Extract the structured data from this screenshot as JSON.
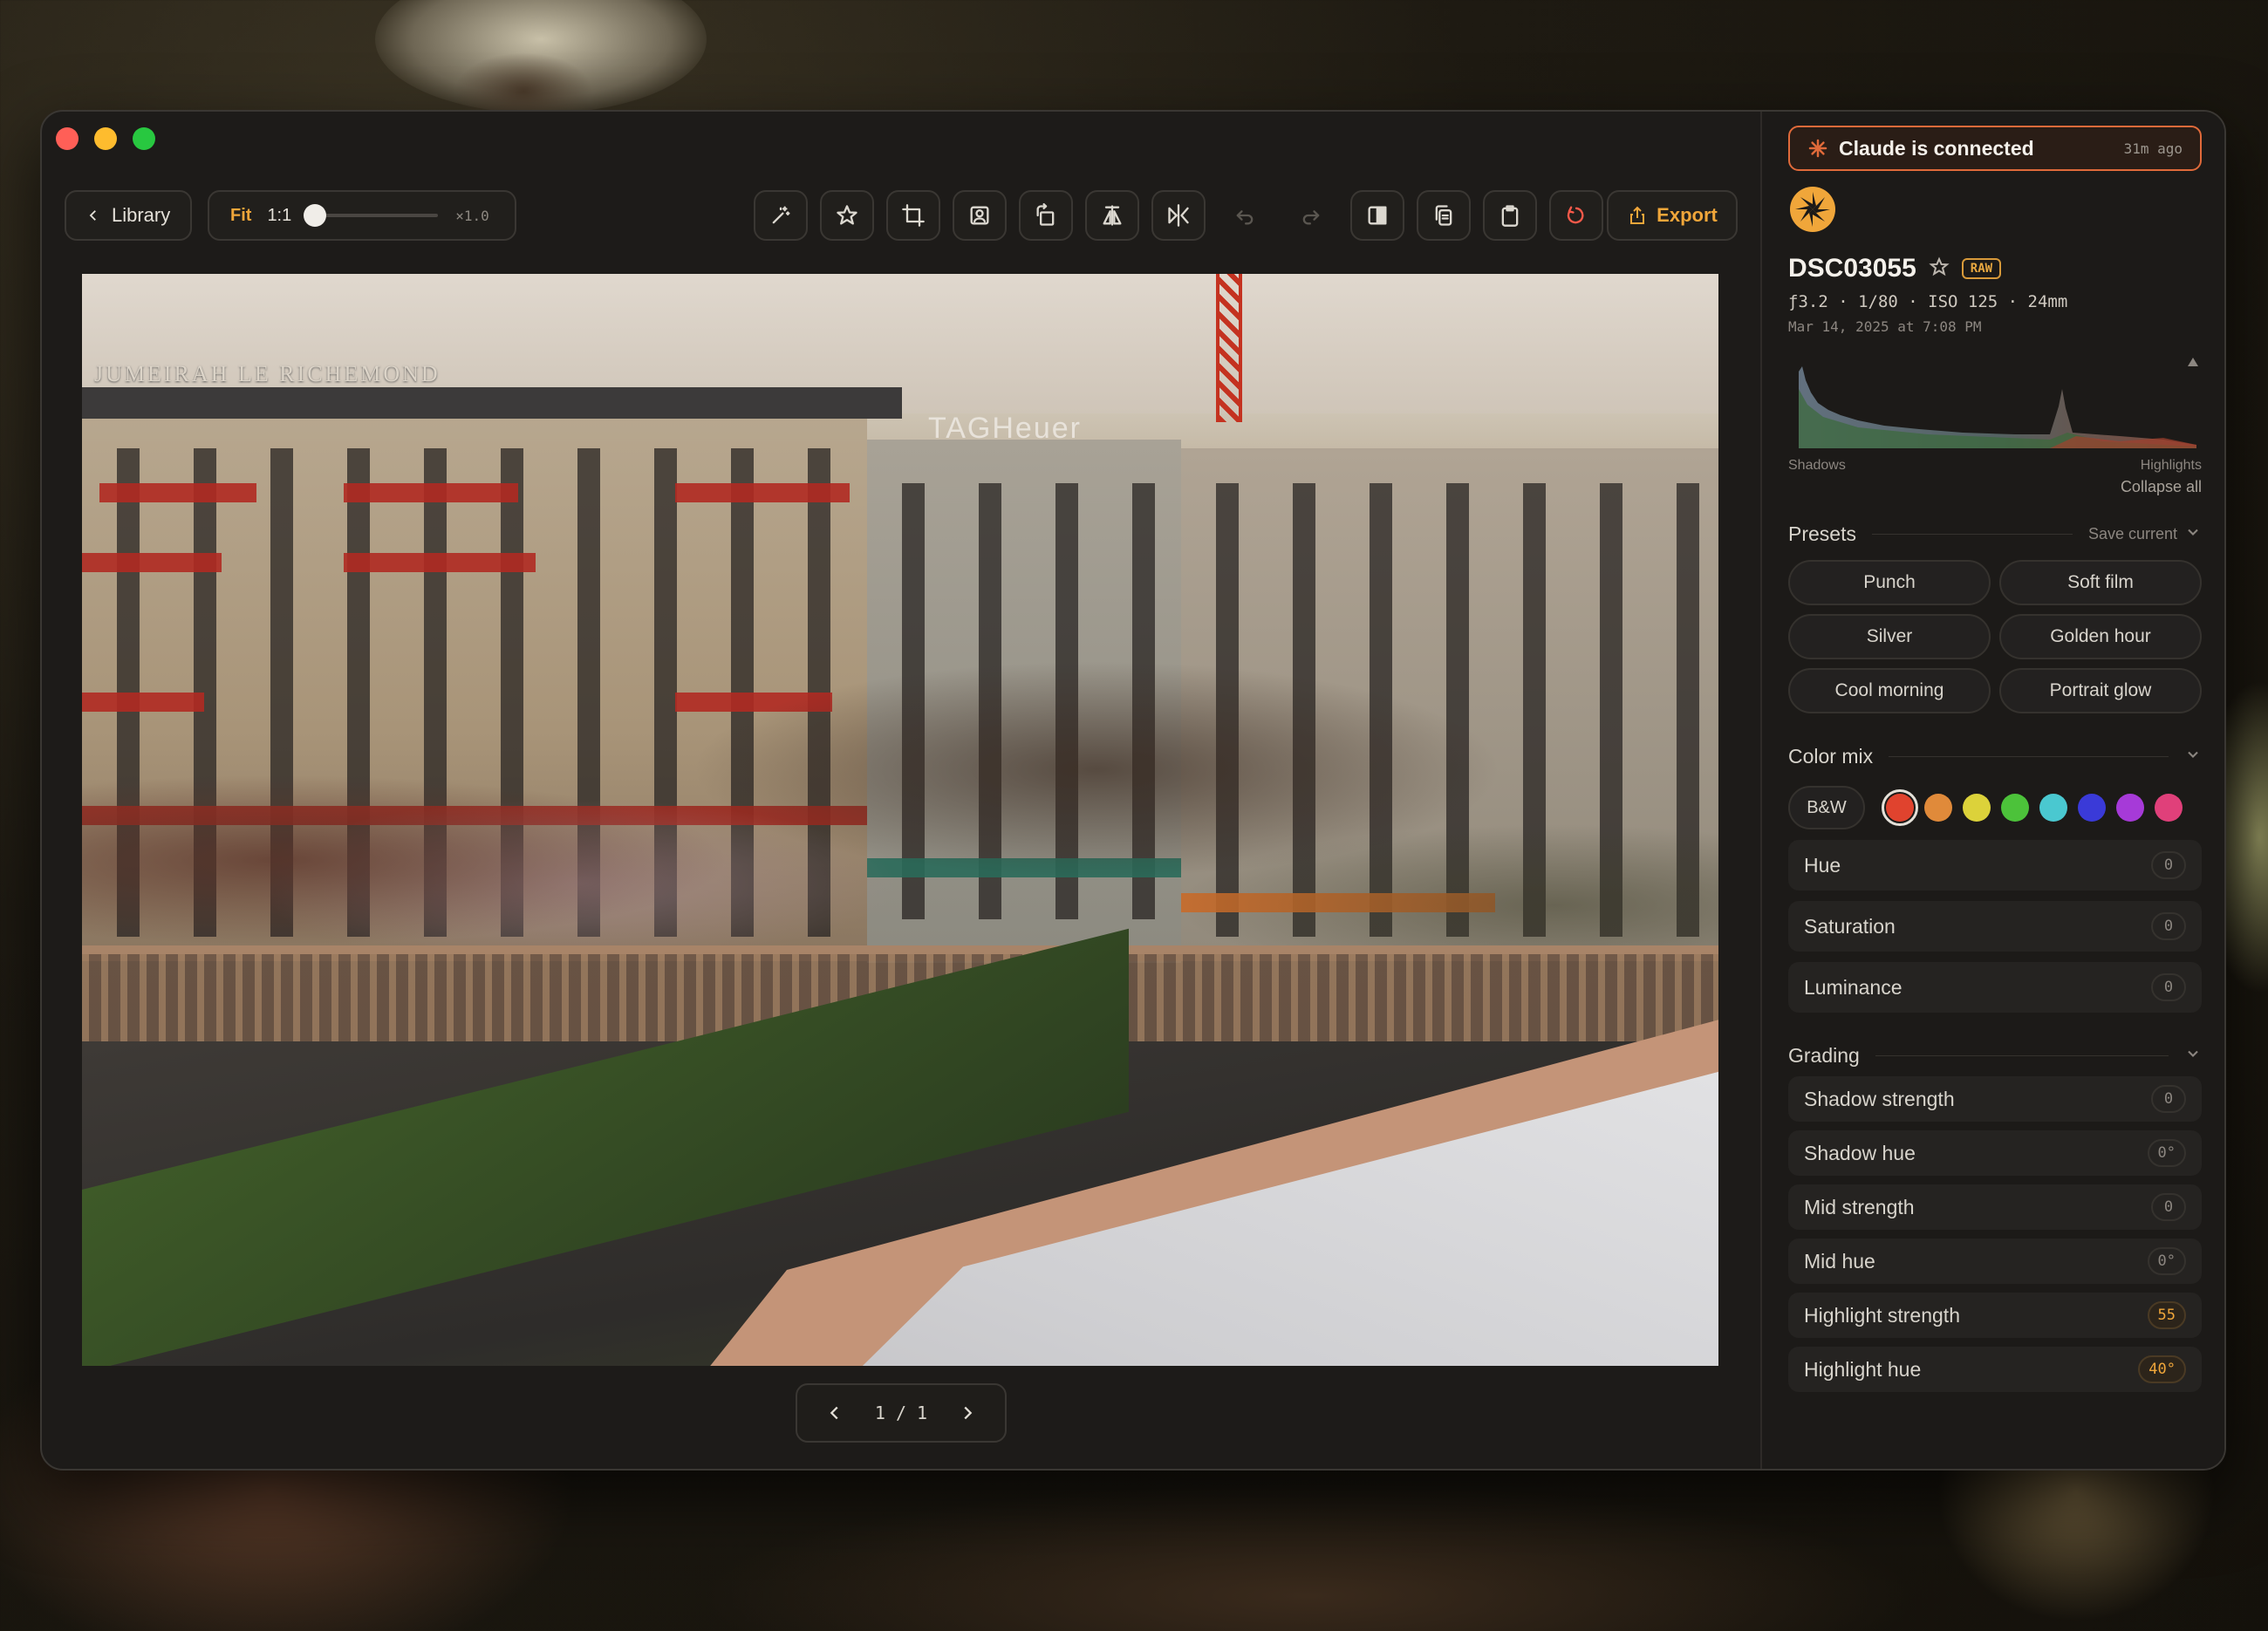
{
  "toolbar": {
    "library_label": "Library",
    "fit_label": "Fit",
    "one_to_one_label": "1:1",
    "zoom_multiplier": "×1.0",
    "zoom_value": 0.0,
    "export_label": "Export"
  },
  "photo": {
    "sign_left": "JUMEIRAH LE RICHEMOND",
    "sign_center": "TAGHeuer"
  },
  "pager": {
    "text": "1 / 1"
  },
  "sidebar": {
    "claude_status": "Claude is connected",
    "claude_ago": "31m ago",
    "file_name": "DSC03055",
    "raw_badge": "RAW",
    "exif": "ƒ3.2 · 1/80 · ISO 125 · 24mm",
    "date": "Mar 14, 2025 at 7:08 PM",
    "hist_shadows": "Shadows",
    "hist_highlights": "Highlights",
    "collapse_all": "Collapse all",
    "presets": {
      "title": "Presets",
      "save_current": "Save current",
      "items": [
        "Punch",
        "Soft film",
        "Silver",
        "Golden hour",
        "Cool morning",
        "Portrait glow"
      ]
    },
    "color_mix": {
      "title": "Color mix",
      "bw_label": "B&W",
      "swatches": [
        "#e0432e",
        "#e08a3a",
        "#dcd23a",
        "#4cc23a",
        "#4ac8d0",
        "#3a3ad8",
        "#a63ad8",
        "#e0407a"
      ],
      "rows": [
        {
          "label": "Hue",
          "value": "0"
        },
        {
          "label": "Saturation",
          "value": "0"
        },
        {
          "label": "Luminance",
          "value": "0"
        }
      ]
    },
    "grading": {
      "title": "Grading",
      "rows": [
        {
          "label": "Shadow strength",
          "value": "0",
          "active": false
        },
        {
          "label": "Shadow hue",
          "value": "0°",
          "active": false
        },
        {
          "label": "Mid strength",
          "value": "0",
          "active": false
        },
        {
          "label": "Mid hue",
          "value": "0°",
          "active": false
        },
        {
          "label": "Highlight strength",
          "value": "55",
          "active": true
        },
        {
          "label": "Highlight hue",
          "value": "40°",
          "active": true
        }
      ]
    }
  },
  "colors": {
    "accent": "#f0a63a",
    "claude_border": "#e06a3a",
    "revert": "#ff5a4a"
  }
}
